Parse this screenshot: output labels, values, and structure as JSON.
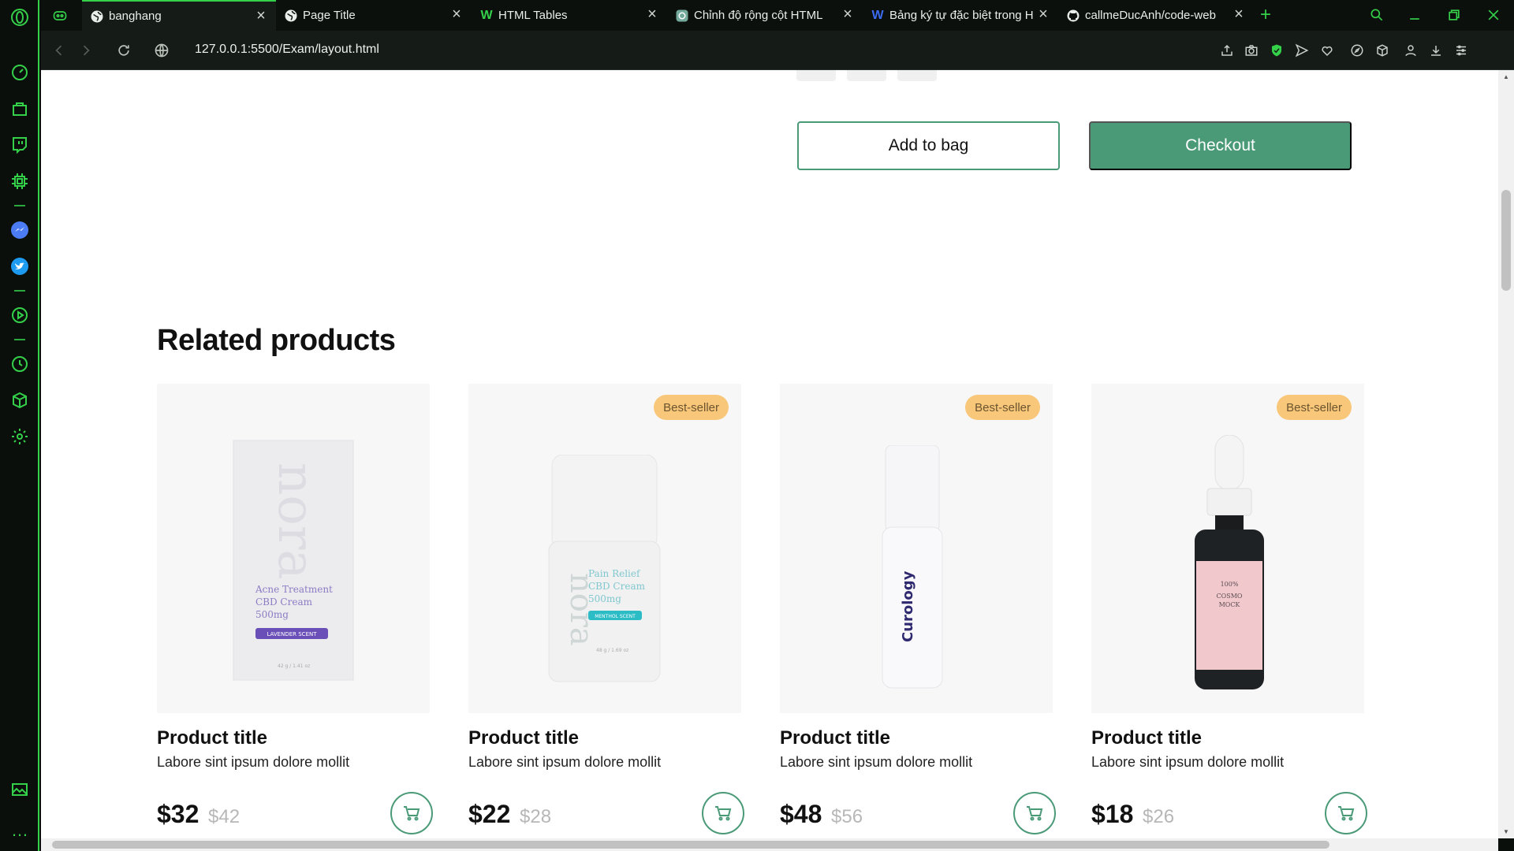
{
  "browser": {
    "tabs": [
      {
        "label": "banghang",
        "active": true,
        "icon": "globe-icon"
      },
      {
        "label": "Page Title",
        "active": false,
        "icon": "globe-icon"
      },
      {
        "label": "HTML Tables",
        "active": false,
        "icon": "w3schools-icon"
      },
      {
        "label": "Chỉnh độ rộng cột HTML",
        "active": false,
        "icon": "chatgpt-icon"
      },
      {
        "label": "Bảng ký tự đặc biệt trong H",
        "active": false,
        "icon": "w-logo-icon"
      },
      {
        "label": "callmeDucAnh/code-web",
        "active": false,
        "icon": "github-icon"
      }
    ],
    "url": "127.0.0.1:5500/Exam/layout.html"
  },
  "product": {
    "add_to_bag_label": "Add to bag",
    "checkout_label": "Checkout"
  },
  "related": {
    "heading": "Related products",
    "items": [
      {
        "title": "Product title",
        "desc": "Labore sint ipsum dolore mollit",
        "price": "$32",
        "old_price": "$42",
        "badge": "",
        "image": "nora-box",
        "image_text": {
          "brand": "nora",
          "line1": "Acne Treatment",
          "line2": "CBD Cream",
          "line3": "500mg",
          "tag": "LAVENDER SCENT",
          "size": "42 g / 1.41 oz"
        }
      },
      {
        "title": "Product title",
        "desc": "Labore sint ipsum dolore mollit",
        "price": "$22",
        "old_price": "$28",
        "badge": "Best-seller",
        "image": "nora-jar",
        "image_text": {
          "brand": "nora",
          "line1": "Pain Relief",
          "line2": "CBD Cream",
          "line3": "500mg",
          "tag": "MENTHOL SCENT",
          "size": "48 g / 1.69 oz"
        }
      },
      {
        "title": "Product title",
        "desc": "Labore sint ipsum dolore mollit",
        "price": "$48",
        "old_price": "$56",
        "badge": "Best-seller",
        "image": "curology-bottle",
        "image_text": {
          "brand": "Curology"
        }
      },
      {
        "title": "Product title",
        "desc": "Labore sint ipsum dolore mollit",
        "price": "$18",
        "old_price": "$26",
        "badge": "Best-seller",
        "image": "dropper-bottle",
        "image_text": {
          "line1": "100%",
          "line2": "COSMO",
          "line3": "MOCK"
        }
      }
    ]
  },
  "colors": {
    "accent": "#4a9a78",
    "badge": "#f8c779",
    "opera_green": "#35d04a"
  }
}
